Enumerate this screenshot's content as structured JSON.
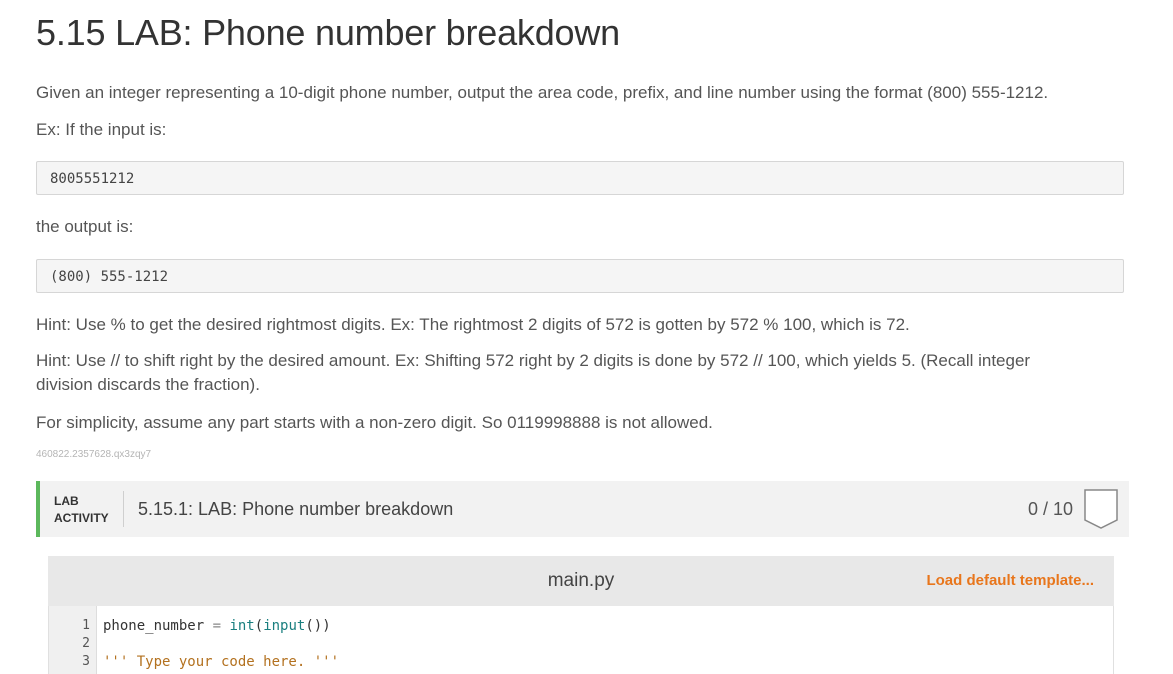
{
  "page": {
    "title": "5.15 LAB: Phone number breakdown",
    "intro": "Given an integer representing a 10-digit phone number, output the area code, prefix, and line number using the format (800) 555-1212.",
    "ex_input_label": "Ex: If the input is:",
    "example_input": "8005551212",
    "output_label": "the output is:",
    "example_output": "(800) 555-1212",
    "hint1": "Hint: Use % to get the desired rightmost digits. Ex: The rightmost 2 digits of 572 is gotten by 572 % 100, which is 72.",
    "hint2": "Hint: Use // to shift right by the desired amount. Ex: Shifting 572 right by 2 digits is done by 572 // 100, which yields 5. (Recall integer division discards the fraction).",
    "simplicity": "For simplicity, assume any part starts with a non-zero digit. So 0119998888 is not allowed.",
    "tracking_id": "460822.2357628.qx3zqy7"
  },
  "lab": {
    "tag_line1": "LAB",
    "tag_line2": "ACTIVITY",
    "title": "5.15.1: LAB: Phone number breakdown",
    "score": "0 / 10",
    "accent_color": "#5cb85c"
  },
  "editor": {
    "filename": "main.py",
    "load_template": "Load default template...",
    "line_numbers": [
      "1",
      "2",
      "3"
    ],
    "lines": {
      "l1_var": "phone_number",
      "l1_eq": " = ",
      "l1_fn1": "int",
      "l1_p1": "(",
      "l1_fn2": "input",
      "l1_p2": "())",
      "l3_str": "''' Type your code here. '''"
    }
  }
}
